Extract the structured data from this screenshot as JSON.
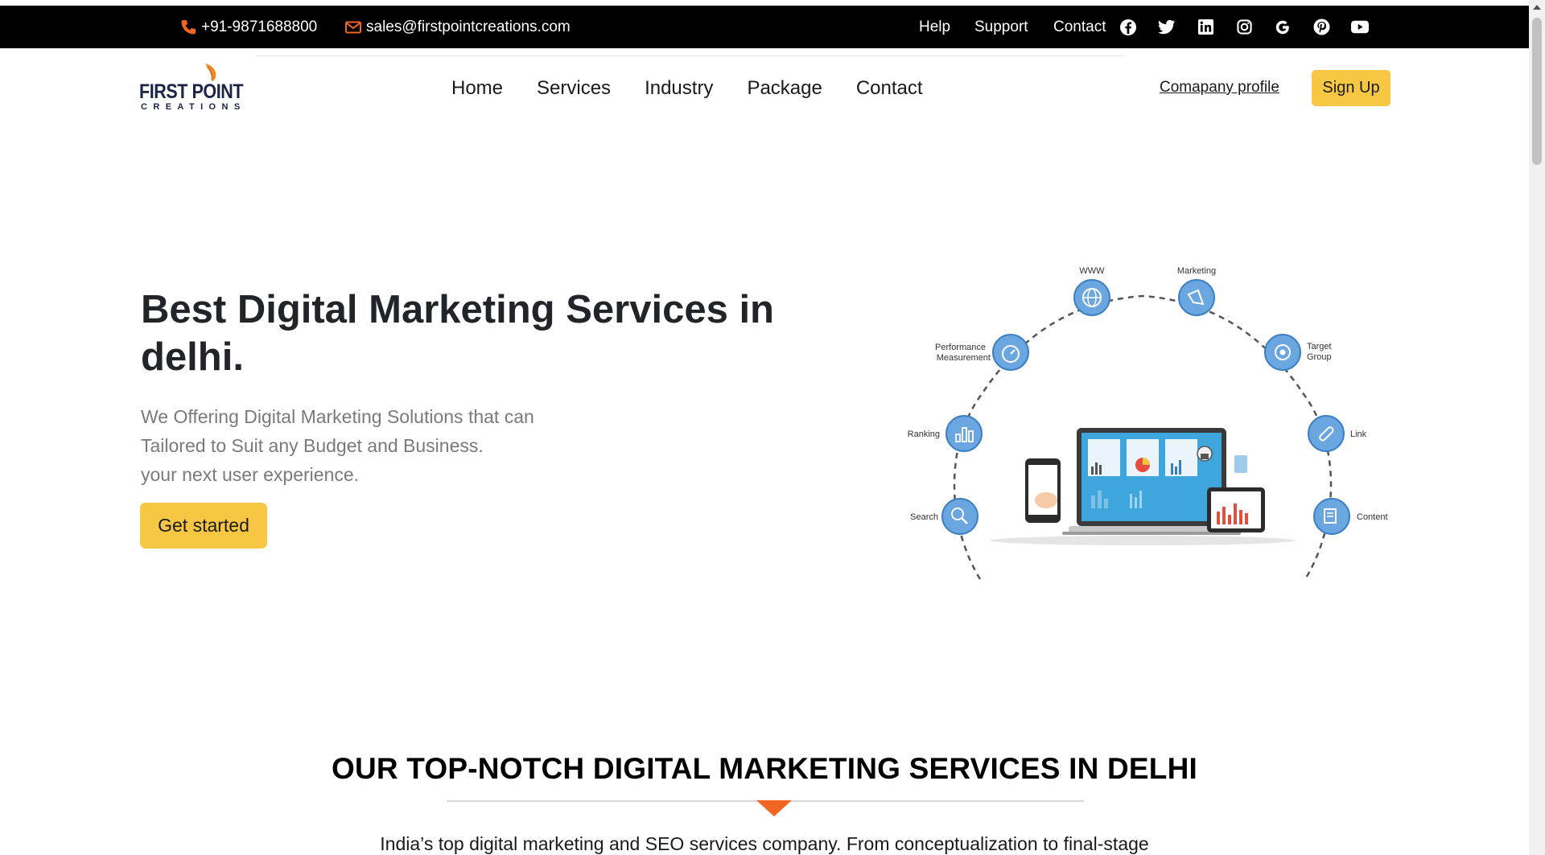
{
  "topbar": {
    "phone": "+91-9871688800",
    "email": "sales@firstpointcreations.com",
    "links": [
      "Help",
      "Support",
      "Contact"
    ],
    "socials": [
      "facebook-icon",
      "twitter-icon",
      "linkedin-icon",
      "instagram-icon",
      "google-icon",
      "pinterest-icon",
      "youtube-icon"
    ]
  },
  "header": {
    "logo_line1": "FIRST POINT",
    "logo_line2": "CREATIONS",
    "nav": [
      "Home",
      "Services",
      "Industry",
      "Package",
      "Contact"
    ],
    "company_profile": "Comapany profile",
    "signup": "Sign Up"
  },
  "hero": {
    "title": "Best Digital Marketing Services in delhi.",
    "subtitle_lines": [
      "We Offering Digital Marketing Solutions that can",
      "Tailored to Suit any Budget and Business.",
      "your next user experience."
    ],
    "cta": "Get started",
    "art_labels": {
      "www": "WWW",
      "marketing": "Marketing",
      "performance_1": "Performance",
      "performance_2": "Measurement",
      "target_1": "Target",
      "target_2": "Group",
      "ranking": "Ranking",
      "link": "Link",
      "search": "Search",
      "content": "Content"
    }
  },
  "services_section": {
    "title": "OUR TOP-NOTCH DIGITAL MARKETING SERVICES IN DELHI",
    "description": "India’s top digital marketing and SEO services company. From conceptualization to final-stage"
  },
  "colors": {
    "accent_yellow": "#f7c744",
    "accent_orange": "#f26522",
    "topbar_bg": "#000000",
    "icon_blue": "#5b9bd5"
  }
}
